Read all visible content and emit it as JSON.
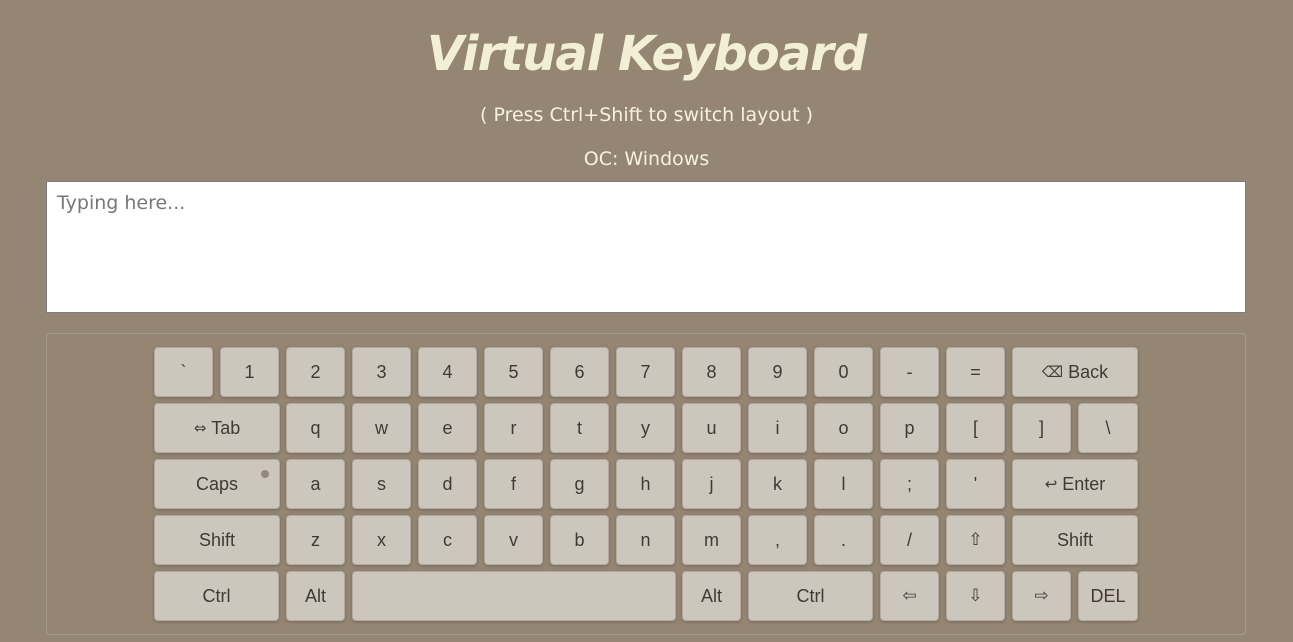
{
  "header": {
    "title": "Virtual Keyboard",
    "subtitle": "( Press Ctrl+Shift to switch layout )",
    "os_label": "OC: Windows"
  },
  "input": {
    "placeholder": "Typing here..."
  },
  "keyboard": {
    "row1": [
      "`",
      "1",
      "2",
      "3",
      "4",
      "5",
      "6",
      "7",
      "8",
      "9",
      "0",
      "-",
      "="
    ],
    "back": "Back",
    "tab": "Tab",
    "row2": [
      "q",
      "w",
      "e",
      "r",
      "t",
      "y",
      "u",
      "i",
      "o",
      "p",
      "[",
      "]",
      "\\"
    ],
    "caps": "Caps",
    "row3": [
      "a",
      "s",
      "d",
      "f",
      "g",
      "h",
      "j",
      "k",
      "l",
      ";",
      "'"
    ],
    "enter": "Enter",
    "shift_left": "Shift",
    "row4": [
      "z",
      "x",
      "c",
      "v",
      "b",
      "n",
      "m",
      ",",
      ".",
      "/"
    ],
    "shift_right": "Shift",
    "ctrl_left": "Ctrl",
    "alt_left": "Alt",
    "alt_right": "Alt",
    "ctrl_right": "Ctrl",
    "del": "DEL",
    "icons": {
      "back": "backspace-icon",
      "tab": "tab-arrow-icon",
      "enter": "enter-return-icon",
      "arrow_up": "arrow-up-icon",
      "arrow_left": "arrow-left-icon",
      "arrow_down": "arrow-down-icon",
      "arrow_right": "arrow-right-icon"
    }
  }
}
